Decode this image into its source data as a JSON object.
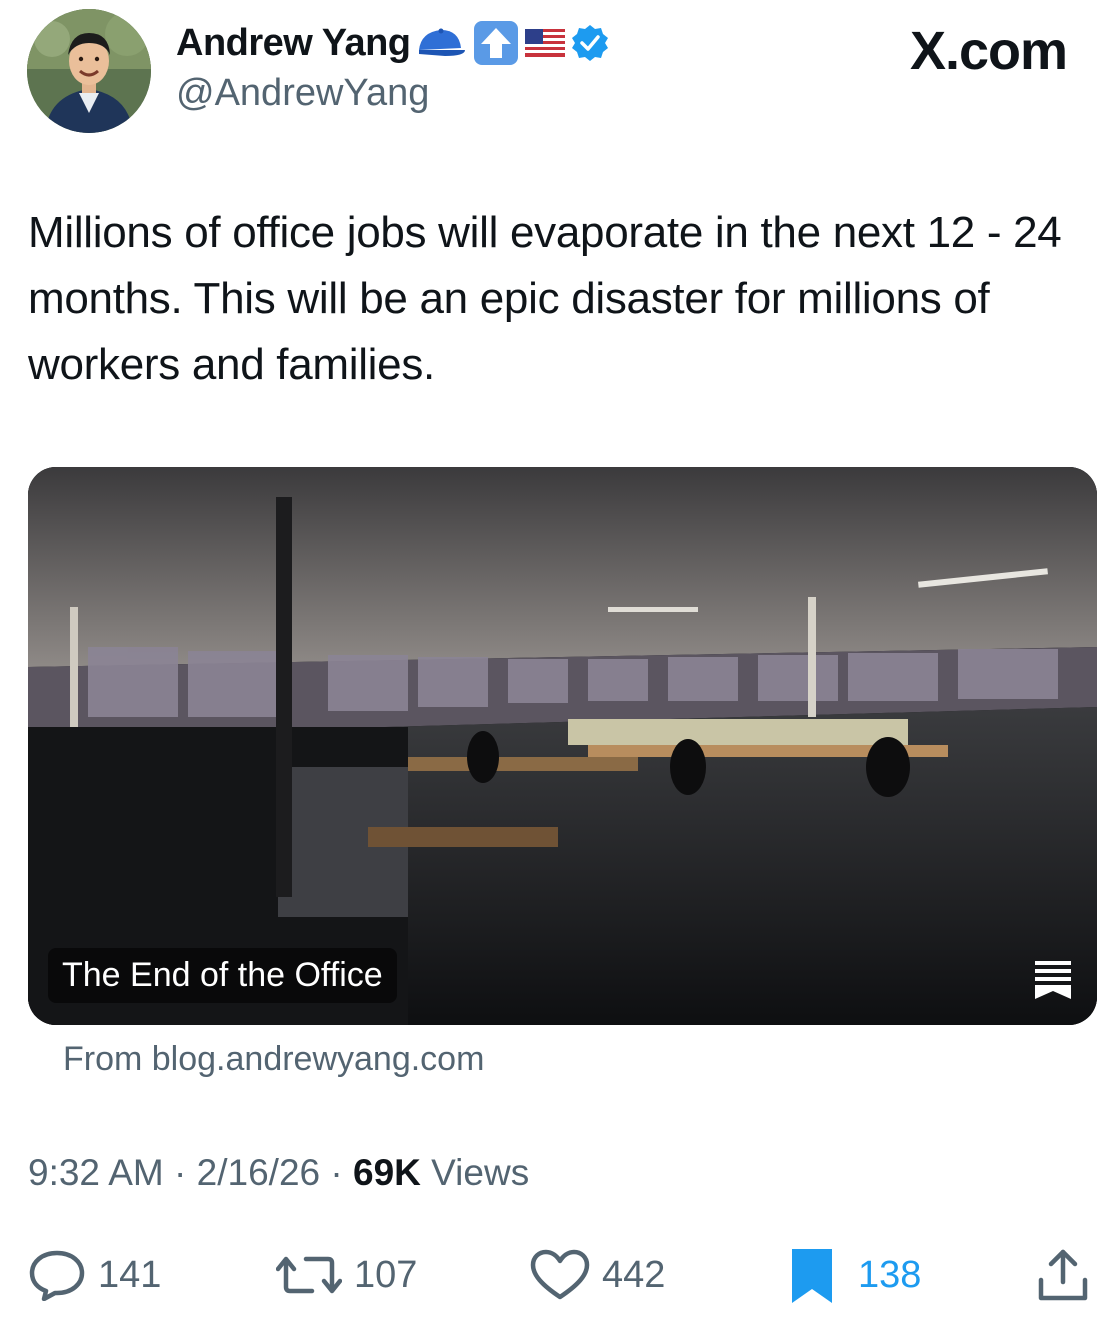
{
  "author": {
    "name": "Andrew Yang",
    "handle": "@AndrewYang",
    "badges": [
      "blue-cap-icon",
      "up-arrow-icon",
      "us-flag-icon",
      "verified-badge-icon"
    ]
  },
  "site": "X.com",
  "tweet": {
    "text": "Millions of office jobs will evaporate in the next 12 - 24 months.  This will be an epic disaster for millions of workers and families."
  },
  "card": {
    "title": "The End of the Office",
    "source": "From blog.andrewyang.com"
  },
  "meta": {
    "time": "9:32 AM",
    "separator": "·",
    "date": "2/16/26",
    "views_count": "69K",
    "views_label": "Views"
  },
  "actions": {
    "replies": "141",
    "reposts": "107",
    "likes": "442",
    "bookmarks": "138"
  },
  "colors": {
    "text": "#0f1419",
    "muted": "#536471",
    "accent": "#1d9bf0"
  }
}
